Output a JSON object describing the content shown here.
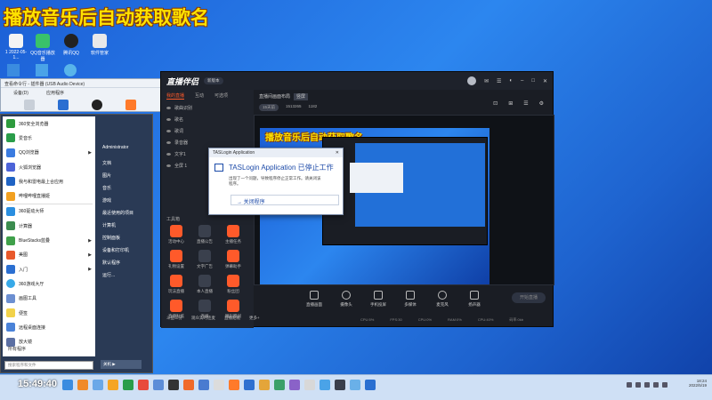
{
  "banner": "播放音乐后自动获取歌名",
  "desktop_icons": [
    {
      "label": "1\n2022-05-1..."
    },
    {
      "label": "QQ音乐播放器"
    },
    {
      "label": "腾讯QQ"
    },
    {
      "label": "软件管家"
    }
  ],
  "player": {
    "title": "查看命令行 - 插件器 (USB Audio Device)",
    "tabs": [
      "设备(D)",
      "应用程序"
    ]
  },
  "start_menu": {
    "items": [
      {
        "label": "360安全浏览器",
        "color": "#2d9b3d",
        "arrow": false
      },
      {
        "label": "爱音乐",
        "color": "#2a9d4a",
        "arrow": false
      },
      {
        "label": "QQ浏览器",
        "color": "#3a7be0",
        "arrow": true
      },
      {
        "label": "火狐浏览器",
        "color": "#4c63d8",
        "arrow": false
      },
      {
        "label": "我与和雷电最上合应用",
        "color": "#1f63c4",
        "arrow": false
      },
      {
        "label": "哔哩哔哩直播姬",
        "color": "#f2a020",
        "arrow": false
      },
      {
        "label": "360驱动大师",
        "color": "#2a8ee0",
        "arrow": false
      },
      {
        "label": "计算器",
        "color": "#3b8c4f",
        "arrow": false
      },
      {
        "label": "BlueStacks蓝叠",
        "color": "#3fa04a",
        "arrow": true
      },
      {
        "label": "美图",
        "color": "#e8582b",
        "arrow": true
      },
      {
        "label": "入门",
        "color": "#2b6fd1",
        "arrow": true
      },
      {
        "label": "360游戏大厅",
        "color": "#37a9e8",
        "arrow": false
      },
      {
        "label": "画图工具",
        "color": "#6c8fd1",
        "arrow": false
      },
      {
        "label": "便签",
        "color": "#f2d24a",
        "arrow": false
      },
      {
        "label": "远程桌面连接",
        "color": "#4a82d8",
        "arrow": false
      },
      {
        "label": "放大镜",
        "color": "#5b6fa3",
        "arrow": false
      }
    ],
    "all_programs": "所有程序",
    "search_placeholder": "搜索程序和文件",
    "right_items": [
      "Administrator",
      "文档",
      "图片",
      "音乐",
      "游戏",
      "最近使用的项目",
      "计算机",
      "控制面板",
      "设备和打印机",
      "默认程序",
      "运行..."
    ],
    "shutdown": "关机"
  },
  "app": {
    "logo": "直播伴侣",
    "badge": "新版本",
    "left_tabs": [
      "我的直播",
      "互动",
      "可选项"
    ],
    "scenes": [
      "歌曲识别",
      "歌名",
      "歌词",
      "录音器",
      "文字1",
      "全屏 1"
    ],
    "tools_label": "工具箱",
    "tools": [
      "活动中心",
      "直播公告",
      "主播任务",
      "礼物设置",
      "文字广告",
      "弹幕助手",
      "玩法直播",
      "本人直播",
      "粉丝团",
      "直播贴纸",
      "连线",
      "精彩瞬间"
    ],
    "bottom_left": [
      "斗鱼三分",
      "观众实时连麦",
      "直播贴纸",
      "更多+"
    ],
    "main_head": "直播间画面布局",
    "main_head_opt": "竖屏",
    "main_sub": [
      "15天前",
      "1513265",
      "1182"
    ],
    "preview_title": "播放音乐后自动获取歌名",
    "controls": [
      "直播画面",
      "摄像头",
      "手机投屏",
      "多媒体",
      "麦克风",
      "扬声器"
    ],
    "start_live": "开始直播",
    "status": [
      "CPU:5%",
      "FPS:30",
      "CPU:0%",
      "RAM:0%",
      "CPU:40%",
      "码率:0kb"
    ]
  },
  "dialog": {
    "title": "TASLogin Application",
    "heading": "TASLogin Application 已停止工作",
    "text": "出现了一个问题，导致程序停止正常工作。请关闭该程序。",
    "button": "关闭程序"
  },
  "taskbar": {
    "time_left": "15:49:40",
    "time": "18:24",
    "date": "2022/5/19"
  }
}
